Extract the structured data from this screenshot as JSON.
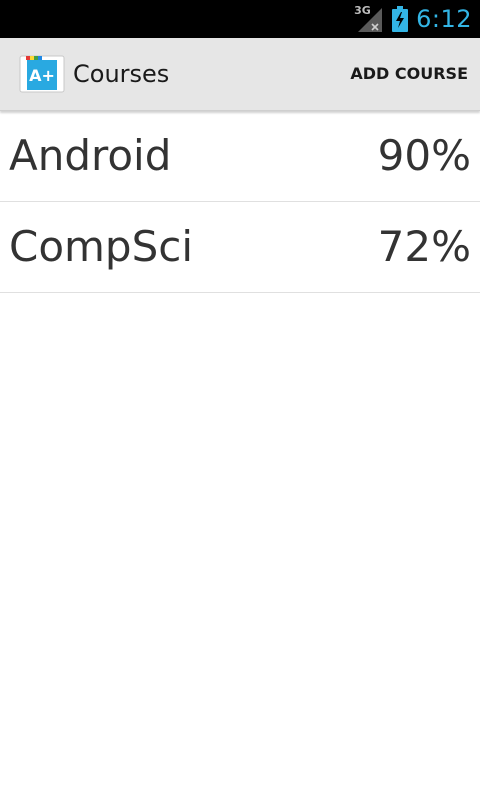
{
  "status_bar": {
    "network_label": "3G",
    "time": "6:12",
    "colors": {
      "clock": "#33b5e5",
      "background": "#000000"
    },
    "icons": [
      "signal-icon",
      "battery-charging-icon"
    ]
  },
  "action_bar": {
    "title": "Courses",
    "app_icon_text": "A+",
    "add_course_label": "ADD COURSE"
  },
  "courses": [
    {
      "name": "Android",
      "grade": "90%"
    },
    {
      "name": "CompSci",
      "grade": "72%"
    }
  ]
}
